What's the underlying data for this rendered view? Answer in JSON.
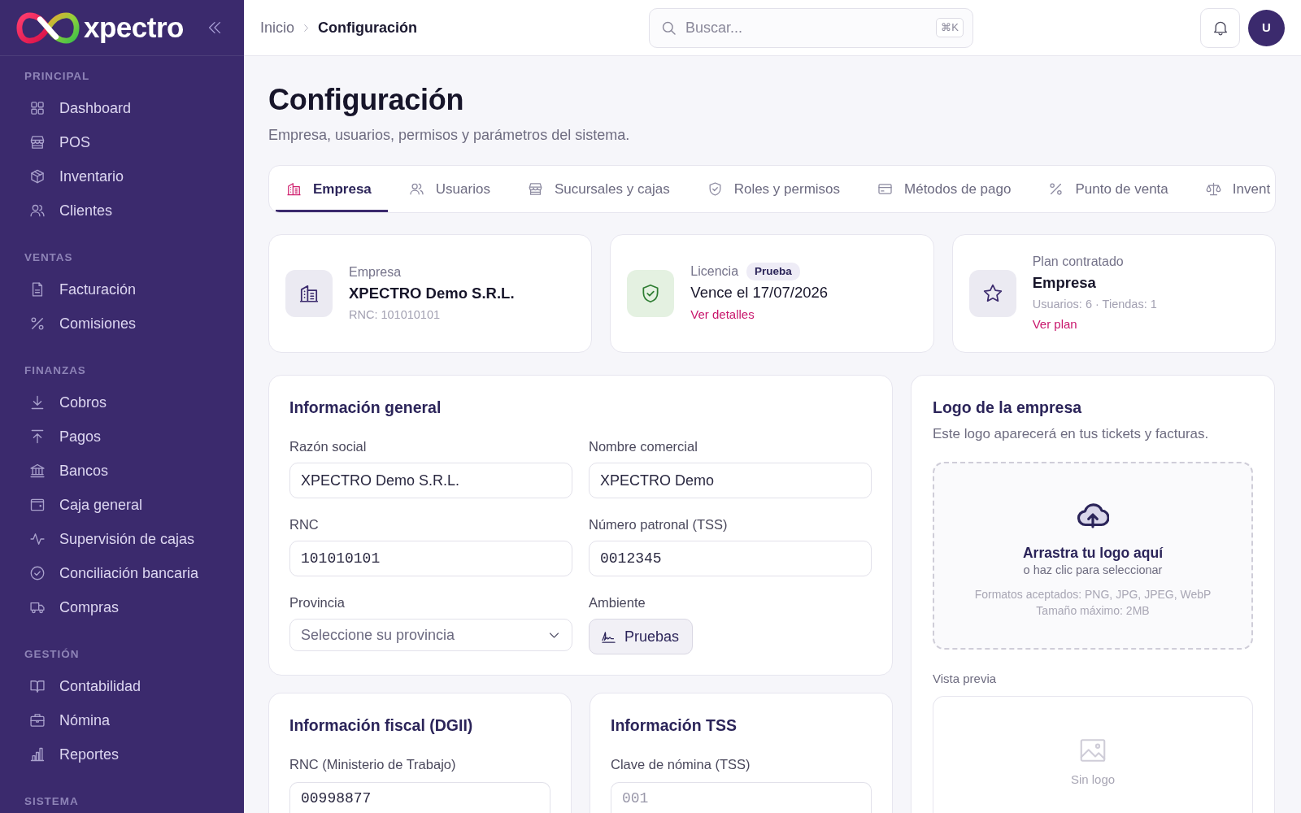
{
  "sidebar": {
    "brand": "xpectro",
    "sections": [
      {
        "title": "PRINCIPAL",
        "items": [
          "Dashboard",
          "POS",
          "Inventario",
          "Clientes"
        ]
      },
      {
        "title": "VENTAS",
        "items": [
          "Facturación",
          "Comisiones"
        ]
      },
      {
        "title": "FINANZAS",
        "items": [
          "Cobros",
          "Pagos",
          "Bancos",
          "Caja general",
          "Supervisión de cajas",
          "Conciliación bancaria",
          "Compras"
        ]
      },
      {
        "title": "GESTIÓN",
        "items": [
          "Contabilidad",
          "Nómina",
          "Reportes"
        ]
      },
      {
        "title": "SISTEMA"
      }
    ]
  },
  "topbar": {
    "breadcrumb": [
      "Inicio",
      "Configuración"
    ],
    "search": {
      "placeholder": "Buscar...",
      "shortcut": "⌘K"
    },
    "avatar": "U"
  },
  "page": {
    "title": "Configuración",
    "subtitle": "Empresa, usuarios, permisos y parámetros del sistema."
  },
  "tabs": [
    {
      "label": "Empresa",
      "selected": true
    },
    {
      "label": "Usuarios",
      "selected": false
    },
    {
      "label": "Sucursales y cajas",
      "selected": false
    },
    {
      "label": "Roles y permisos",
      "selected": false
    },
    {
      "label": "Métodos de pago",
      "selected": false
    },
    {
      "label": "Punto de venta",
      "selected": false
    },
    {
      "label": "Invent",
      "selected": false
    }
  ],
  "summary_cards": [
    {
      "kind": "info",
      "label": "Empresa",
      "value": "XPECTRO Demo S.R.L.",
      "detail": "RNC: 101010101"
    },
    {
      "kind": "status",
      "label": "Licencia",
      "badge": "Prueba",
      "value": "Vence el 17/07/2026",
      "link": "Ver detalles"
    },
    {
      "kind": "info",
      "label": "Plan contratado",
      "value": "Empresa",
      "detail": "Usuarios: 6 · Tiendas: 1",
      "link": "Ver plan"
    }
  ],
  "general_info": {
    "title": "Información general",
    "fields": [
      {
        "kind": "text",
        "label": "Razón social",
        "value": "XPECTRO Demo S.R.L."
      },
      {
        "kind": "text",
        "label": "Nombre comercial",
        "value": "XPECTRO Demo"
      },
      {
        "kind": "number",
        "label": "RNC",
        "value": "101010101"
      },
      {
        "kind": "number",
        "label": "Número patronal (TSS)",
        "value": "0012345"
      },
      {
        "kind": "select",
        "label": "Provincia",
        "placeholder": "Seleccione su provincia"
      },
      {
        "kind": "button",
        "label": "Ambiente",
        "value": "Pruebas"
      }
    ]
  },
  "logo_panel": {
    "title": "Logo de la empresa",
    "subtitle": "Este logo aparecerá en tus tickets y facturas.",
    "dropzone": {
      "title": "Arrastra tu logo aquí",
      "hint": "o haz clic para seleccionar",
      "formats": "Formatos aceptados: PNG, JPG, JPEG, WebP",
      "max_size": "Tamaño máximo: 2MB"
    },
    "preview": {
      "label": "Vista previa",
      "empty_text": "Sin logo"
    }
  },
  "fiscal_info": {
    "title": "Información fiscal (DGII)",
    "fields": [
      {
        "kind": "number",
        "label": "RNC (Ministerio de Trabajo)",
        "value": "00998877"
      }
    ]
  },
  "tss_info": {
    "title": "Información TSS",
    "fields": [
      {
        "kind": "number",
        "label": "Clave de nómina (TSS)",
        "placeholder": "001"
      }
    ]
  }
}
